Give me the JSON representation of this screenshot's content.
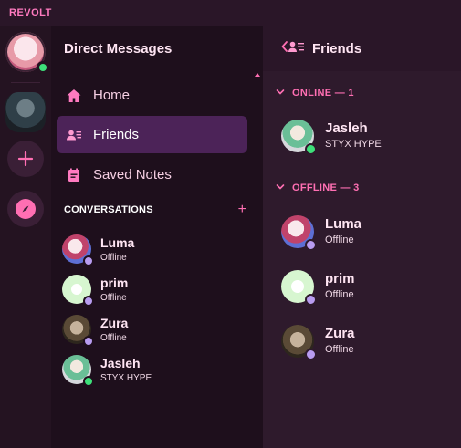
{
  "app": {
    "brand": "REVOLT"
  },
  "colors": {
    "accent": "#ff6fb3",
    "online": "#3ee07a",
    "offline": "#b89cf0",
    "active_nav": "#4c2358"
  },
  "servers": [
    {
      "name": "home-avatar",
      "status": "online"
    },
    {
      "name": "guild"
    },
    {
      "name": "add-server",
      "icon": "plus-icon"
    },
    {
      "name": "discover",
      "icon": "compass-icon"
    }
  ],
  "sidebar": {
    "title": "Direct Messages",
    "nav": [
      {
        "label": "Home",
        "icon": "home-icon"
      },
      {
        "label": "Friends",
        "icon": "friends-icon",
        "active": true
      },
      {
        "label": "Saved Notes",
        "icon": "notes-icon"
      }
    ],
    "conversations_label": "CONVERSATIONS",
    "conversations_add": "+",
    "conversations": [
      {
        "name": "Luma",
        "status_text": "Offline",
        "presence": "offline"
      },
      {
        "name": "prim",
        "status_text": "Offline",
        "presence": "offline"
      },
      {
        "name": "Zura",
        "status_text": "Offline",
        "presence": "offline"
      },
      {
        "name": "Jasleh",
        "status_text": "STYX HYPE",
        "presence": "online"
      }
    ]
  },
  "main": {
    "title": "Friends",
    "online_label": "ONLINE — 1",
    "offline_label": "OFFLINE — 3",
    "online": [
      {
        "name": "Jasleh",
        "status_text": "STYX HYPE"
      }
    ],
    "offline": [
      {
        "name": "Luma",
        "status_text": "Offline"
      },
      {
        "name": "prim",
        "status_text": "Offline"
      },
      {
        "name": "Zura",
        "status_text": "Offline"
      }
    ]
  }
}
